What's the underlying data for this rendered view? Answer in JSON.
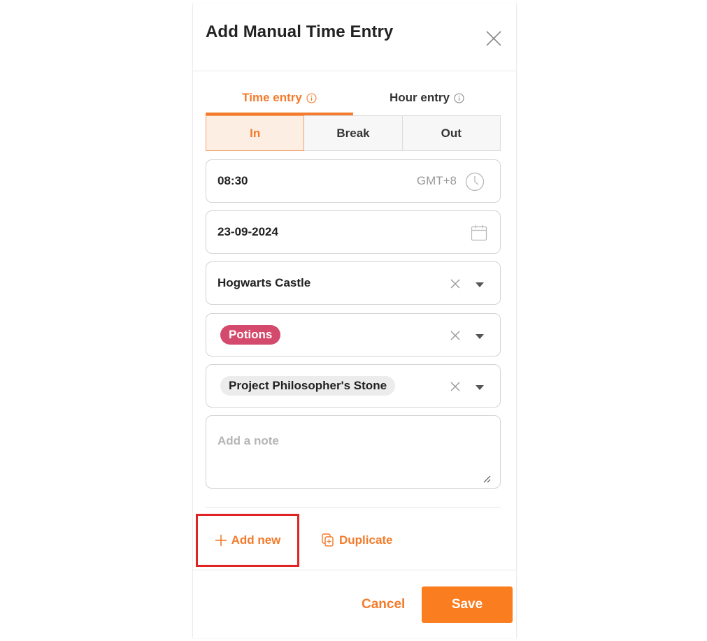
{
  "dialog": {
    "title": "Add Manual Time Entry"
  },
  "tabs": [
    {
      "label": "Time entry"
    },
    {
      "label": "Hour entry"
    }
  ],
  "segments": [
    {
      "label": "In"
    },
    {
      "label": "Break"
    },
    {
      "label": "Out"
    }
  ],
  "time_field": {
    "value": "08:30",
    "timezone": "GMT+8"
  },
  "date_field": {
    "value": "23-09-2024"
  },
  "location_field": {
    "value": "Hogwarts Castle"
  },
  "activity_field": {
    "chip": "Potions"
  },
  "project_field": {
    "chip": "Project Philosopher's Stone"
  },
  "note_field": {
    "placeholder": "Add a note"
  },
  "actions": {
    "add_new": "Add new",
    "duplicate": "Duplicate"
  },
  "footer": {
    "cancel": "Cancel",
    "save": "Save"
  },
  "colors": {
    "accent": "#f37b2b",
    "save_button": "#fa7d1f",
    "activity_chip": "#d44a6d",
    "highlight_box": "#e02424"
  },
  "icons": {
    "close": "close-icon",
    "info": "info-icon",
    "clock": "clock-icon",
    "calendar": "calendar-icon",
    "clear": "clear-x-icon",
    "dropdown": "chevron-down-icon",
    "plus": "plus-icon",
    "duplicate": "duplicate-icon",
    "resize": "resize-grip-icon"
  }
}
